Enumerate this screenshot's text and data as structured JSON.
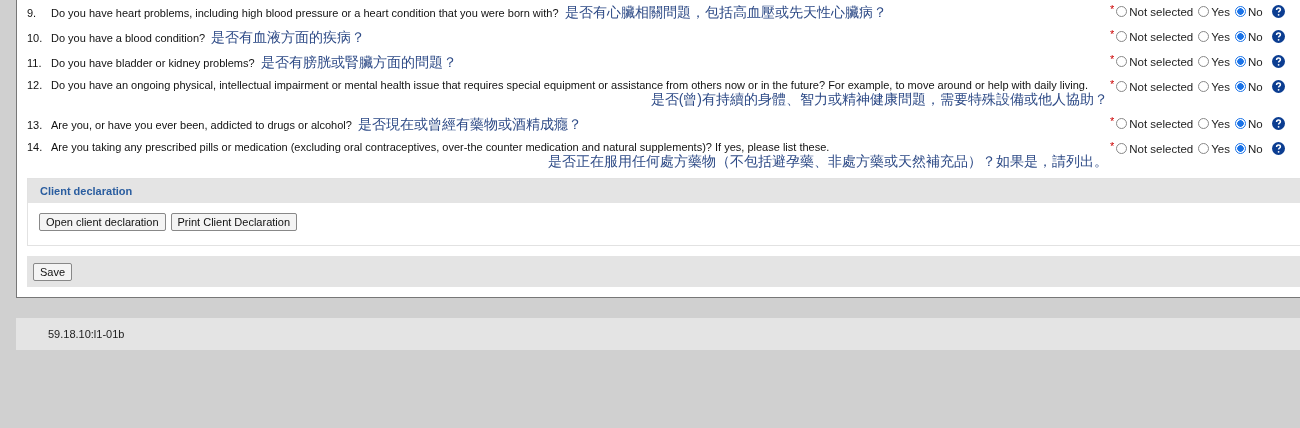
{
  "questions": [
    {
      "number": "9.",
      "text": "Do you have heart problems, including high blood pressure or a heart condition that you were born with?",
      "translation": "是否有心臟相關問題，包括高血壓或先天性心臟病？",
      "kind": "inline",
      "required_mark": "*",
      "options": [
        {
          "label": "Not selected",
          "selected": false
        },
        {
          "label": "Yes",
          "selected": false
        },
        {
          "label": "No",
          "selected": true
        }
      ]
    },
    {
      "number": "10.",
      "text": "Do you have a blood condition?",
      "translation": "是否有血液方面的疾病？",
      "kind": "inline",
      "required_mark": "*",
      "options": [
        {
          "label": "Not selected",
          "selected": false
        },
        {
          "label": "Yes",
          "selected": false
        },
        {
          "label": "No",
          "selected": true
        }
      ]
    },
    {
      "number": "11.",
      "text": "Do you have bladder or kidney problems?",
      "translation": "是否有膀胱或腎臟方面的問題？",
      "kind": "inline",
      "required_mark": "*",
      "options": [
        {
          "label": "Not selected",
          "selected": false
        },
        {
          "label": "Yes",
          "selected": false
        },
        {
          "label": "No",
          "selected": true
        }
      ]
    },
    {
      "number": "12.",
      "text": "Do you have an ongoing physical, intellectual impairment or mental health issue that requires special equipment or assistance from others now or in the future? For example, to move around or help with daily living.",
      "translation": "是否(曾)有持續的身體、智力或精神健康問題，需要特殊設備或他人協助？",
      "kind": "below",
      "required_mark": "*",
      "options": [
        {
          "label": "Not selected",
          "selected": false
        },
        {
          "label": "Yes",
          "selected": false
        },
        {
          "label": "No",
          "selected": true
        }
      ]
    },
    {
      "number": "13.",
      "text": "Are you, or have you ever been, addicted to drugs or alcohol?",
      "translation": "是否現在或曾經有藥物或酒精成癮？",
      "kind": "inline",
      "required_mark": "*",
      "options": [
        {
          "label": "Not selected",
          "selected": false
        },
        {
          "label": "Yes",
          "selected": false
        },
        {
          "label": "No",
          "selected": true
        }
      ]
    },
    {
      "number": "14.",
      "text": "Are you taking any prescribed pills or medication (excluding oral contraceptives, over-the counter medication and natural supplements)? If yes, please list these.",
      "translation": "是否正在服用任何處方藥物（不包括避孕藥、非處方藥或天然補充品）？如果是，請列出。",
      "kind": "below",
      "required_mark": "*",
      "options": [
        {
          "label": "Not selected",
          "selected": false
        },
        {
          "label": "Yes",
          "selected": false
        },
        {
          "label": "No",
          "selected": true
        }
      ]
    }
  ],
  "client_declaration": {
    "title": "Client declaration",
    "buttons": [
      "Open client declaration",
      "Print Client Declaration"
    ]
  },
  "save_button": "Save",
  "footer": {
    "version": "59.18.10:l1-01b"
  }
}
